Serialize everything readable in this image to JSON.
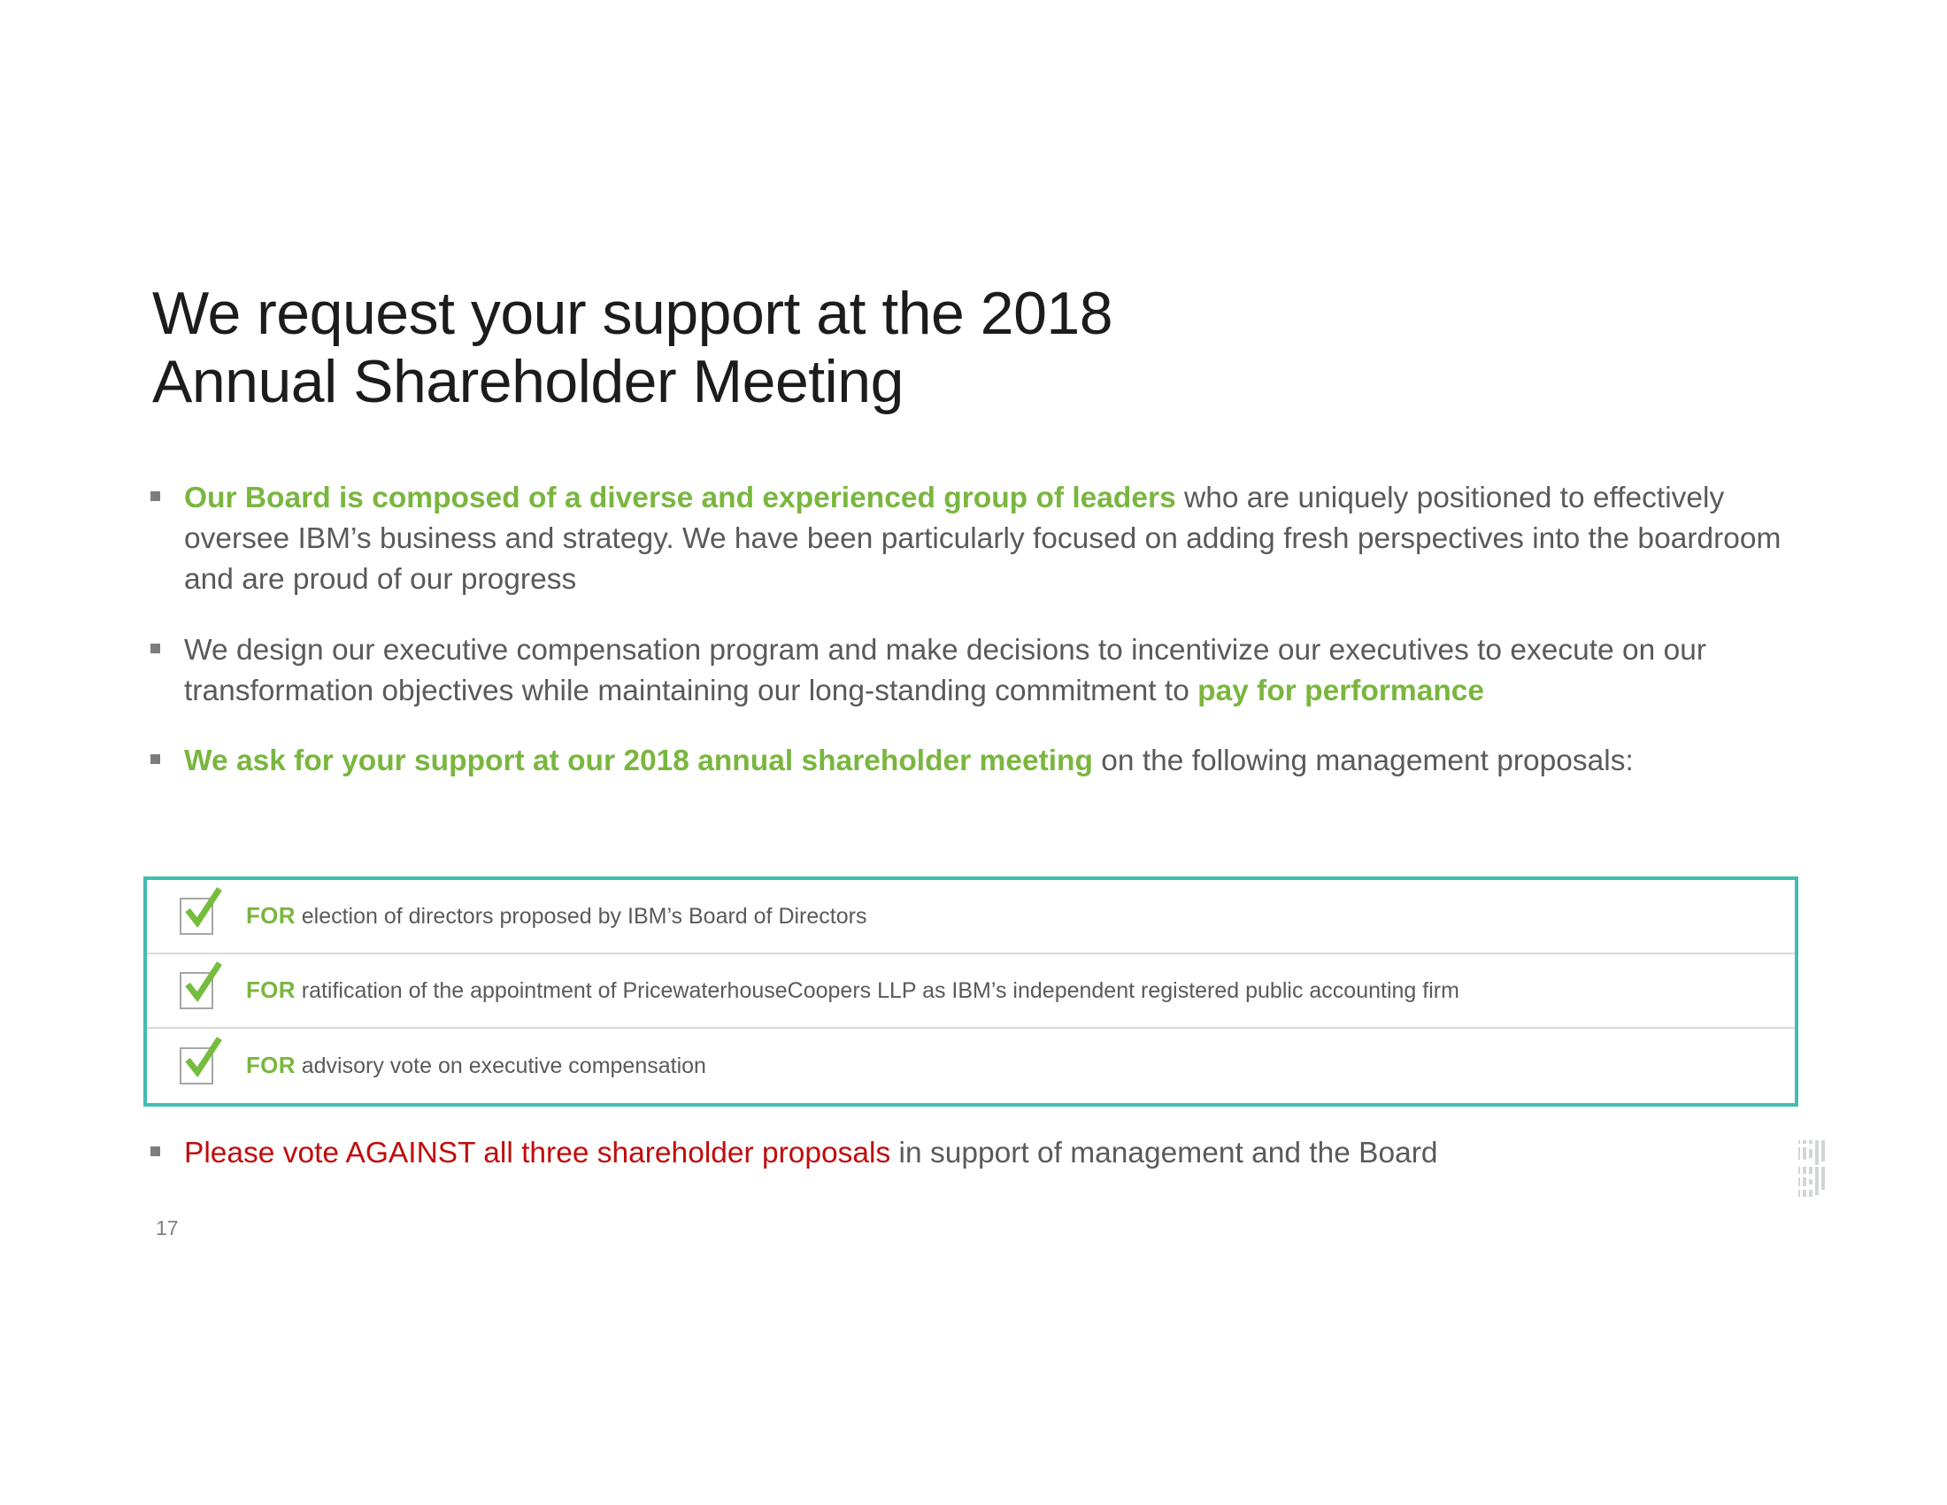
{
  "slide": {
    "page_number": "17",
    "logo": "ibm-logo",
    "colors": {
      "accent_green": "#7ab63f",
      "accent_red": "#c00c0c",
      "table_border_teal": "#41bdb0",
      "body_gray": "#5a5a5a",
      "logo_gray": "#d2d5d8"
    }
  },
  "title": {
    "line1": "We request your support at the 2018",
    "line2": "Annual Shareholder Meeting"
  },
  "bullets": [
    {
      "id": "bullet-board-composition",
      "bold_green": "Our Board is composed of a diverse and experienced group of leaders",
      "rest": " who are uniquely positioned to effectively oversee IBM’s business and strategy. We have been particularly focused on adding fresh perspectives into the boardroom and are proud of our progress"
    },
    {
      "id": "bullet-executive-compensation",
      "lead": "We design our executive compensation program and make decisions to incentivize our executives to execute on our transformation objectives while maintaining our long-standing commitment to ",
      "bold_green": "pay for performance"
    },
    {
      "id": "bullet-support-request",
      "bold_green": "We ask for your support at our 2018 annual shareholder meeting",
      "rest": " on the following management proposals:"
    }
  ],
  "proposals": {
    "rows": [
      {
        "checked": true,
        "vote": "FOR",
        "text": " election of directors proposed by IBM’s Board of Directors"
      },
      {
        "checked": true,
        "vote": "FOR",
        "text": " ratification of the appointment of PricewaterhouseCoopers LLP as IBM’s independent registered public accounting firm"
      },
      {
        "checked": true,
        "vote": "FOR",
        "text": " advisory vote on executive compensation"
      }
    ]
  },
  "final_bullet": {
    "id": "bullet-vote-against",
    "red": "Please vote AGAINST all three shareholder proposals",
    "rest": " in support of management and the Board"
  }
}
